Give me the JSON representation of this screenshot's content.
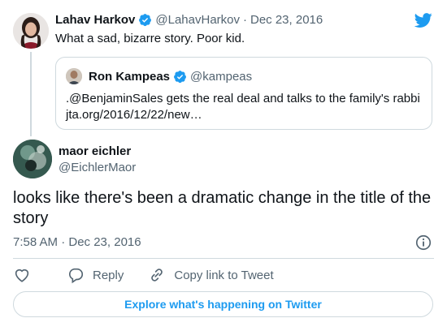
{
  "parent": {
    "name": "Lahav Harkov",
    "handle": "@LahavHarkov",
    "separator": "·",
    "date": "Dec 23, 2016",
    "text": "What a sad, bizarre story. Poor kid."
  },
  "quoted": {
    "name": "Ron Kampeas",
    "handle": "@kampeas",
    "line1": ".@BenjaminSales gets the real deal and talks to the family's rabbi",
    "line2": "jta.org/2016/12/22/new…"
  },
  "reply": {
    "name": "maor eichler",
    "handle": "@EichlerMaor",
    "text": "looks like there's been a dramatic change in the title of the story",
    "timestamp": "7:58 AM · Dec 23, 2016"
  },
  "actions": {
    "reply_label": "Reply",
    "copy_link_label": "Copy link to Tweet"
  },
  "explore_label": "Explore what's happening on Twitter",
  "colors": {
    "accent": "#1d9bf0",
    "text": "#0f1419",
    "muted": "#536471",
    "border": "#cfd9de"
  },
  "icons": [
    "twitter-bird-icon",
    "verified-badge-icon",
    "info-icon",
    "heart-icon",
    "reply-icon",
    "link-icon"
  ]
}
